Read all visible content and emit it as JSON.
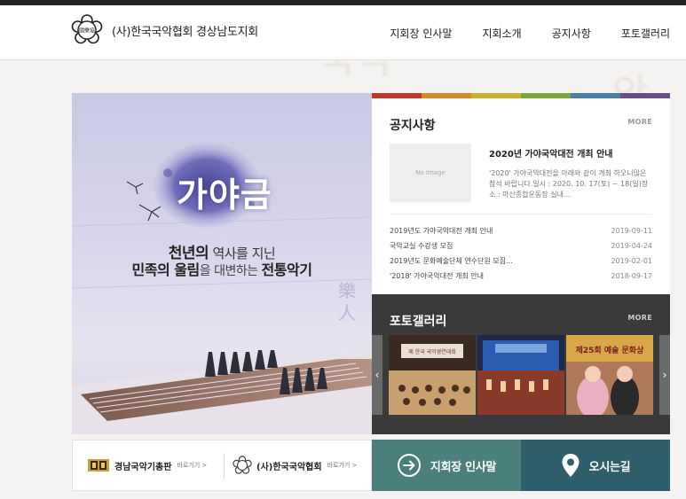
{
  "header": {
    "org_name": "(사)한국국악협회 경상남도지회",
    "emblem_text": "國樂協",
    "nav": [
      "지회장 인사말",
      "지회소개",
      "공지사항",
      "포토갤러리"
    ]
  },
  "hero": {
    "word": "가야금",
    "line1_pre": "천년의",
    "line1_post": " 역사를 지닌",
    "line2_a": "민족의 ",
    "line2_b": "울림",
    "line2_c": "을 대변하는 ",
    "line2_d": "전통악기",
    "slides": 4,
    "active_slide": 1
  },
  "notice": {
    "colors": [
      "#c0392b",
      "#d98a2b",
      "#c9b22e",
      "#7aa63a",
      "#4c7fa8",
      "#6a4c8c"
    ],
    "title": "공지사항",
    "more": "MORE",
    "no_image": "No Image",
    "featured_title": "2020년 가야국악대전 개최 안내",
    "featured_desc": "'2020' 가야국악대전을 아래와 같이 개최 하오니많은 참석 바랍니다.일시 : 2020. 10. 17(토) ~ 18(일)장소 : 마산종합운동장 실내...",
    "items": [
      {
        "title": "2019년도 가야국악대전 개최 안내",
        "date": "2019-09-11"
      },
      {
        "title": "국악교실 수강생 모집",
        "date": "2019-04-24"
      },
      {
        "title": "2019년도 문화예술단체 연수단원 모집...",
        "date": "2019-02-01"
      },
      {
        "title": "'2018' 가야국악대전 개최 안내",
        "date": "2018-09-17"
      }
    ]
  },
  "gallery": {
    "title": "포토갤러리",
    "more": "MORE",
    "thumb1_banner": "제 한국 국악경연대회",
    "thumb3_banner": "제25회 예술 문화상",
    "prev": "‹",
    "next": "›"
  },
  "bottom": {
    "link1_name": "경남국악기총판",
    "link1_go": "바로가기 >",
    "link2_name": "(사)한국국악협회",
    "link2_go": "바로가기 >",
    "greet": "지회장 인사말",
    "map": "오시는길"
  },
  "deco": [
    "한국",
    "국악",
    "한국",
    "국악"
  ]
}
